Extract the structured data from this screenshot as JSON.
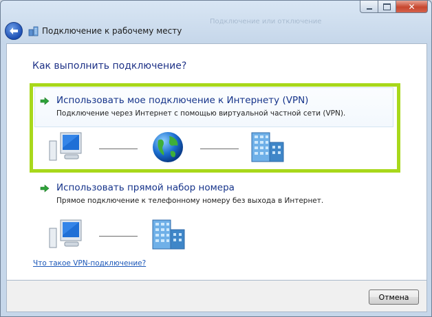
{
  "window": {
    "title_ghost": "Подключение или отключение",
    "nav_title": "Подключение к рабочему месту",
    "caption": {
      "minimize_icon": "minimize-icon",
      "maximize_icon": "maximize-icon",
      "close_icon": "close-icon"
    },
    "accent_highlight": "#a8d81b"
  },
  "main": {
    "heading": "Как выполнить подключение?",
    "options": [
      {
        "title": "Использовать мое подключение к Интернету (VPN)",
        "description": "Подключение через Интернет с помощью виртуальной частной сети (VPN).",
        "icons": [
          "computer-icon",
          "globe-icon",
          "office-building-icon"
        ]
      },
      {
        "title": "Использовать прямой набор номера",
        "description": "Прямое подключение к телефонному номеру без выхода в Интернет.",
        "icons": [
          "computer-icon",
          "office-building-icon"
        ]
      }
    ],
    "help_link": "Что такое VPN-подключение?"
  },
  "footer": {
    "cancel_label": "Отмена"
  }
}
